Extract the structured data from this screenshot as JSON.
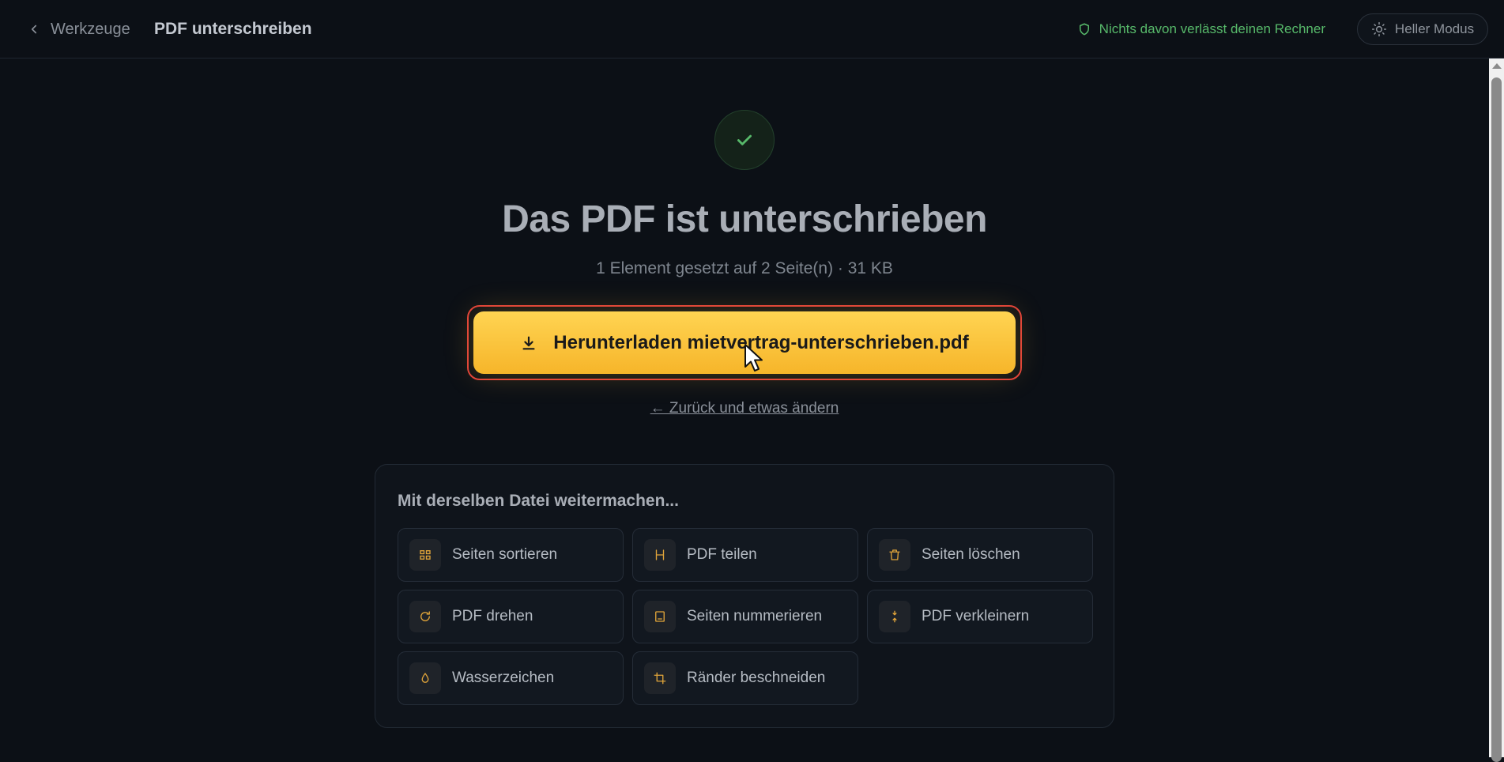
{
  "header": {
    "back_label": "Werkzeuge",
    "page_title": "PDF unterschreiben",
    "privacy_note": "Nichts davon verlässt deinen Rechner",
    "theme_toggle_label": "Heller Modus"
  },
  "result": {
    "headline": "Das PDF ist unterschrieben",
    "summary": "1 Element gesetzt auf 2 Seite(n) · 31 KB",
    "download_label": "Herunterladen mietvertrag-unterschrieben.pdf",
    "back_change_label": "← Zurück und etwas ändern"
  },
  "continue": {
    "title": "Mit derselben Datei weitermachen...",
    "tools": [
      {
        "label": "Seiten sortieren",
        "icon": "grid-icon"
      },
      {
        "label": "PDF teilen",
        "icon": "split-icon"
      },
      {
        "label": "Seiten löschen",
        "icon": "trash-icon"
      },
      {
        "label": "PDF drehen",
        "icon": "rotate-icon"
      },
      {
        "label": "Seiten nummerieren",
        "icon": "page-number-icon"
      },
      {
        "label": "PDF verkleinern",
        "icon": "compress-icon"
      },
      {
        "label": "Wasserzeichen",
        "icon": "droplet-icon"
      },
      {
        "label": "Ränder beschneiden",
        "icon": "crop-icon"
      }
    ]
  },
  "colors": {
    "accent": "#f6b52a",
    "success": "#57b96a",
    "highlight_border": "#e0403a",
    "background": "#0c1016"
  }
}
